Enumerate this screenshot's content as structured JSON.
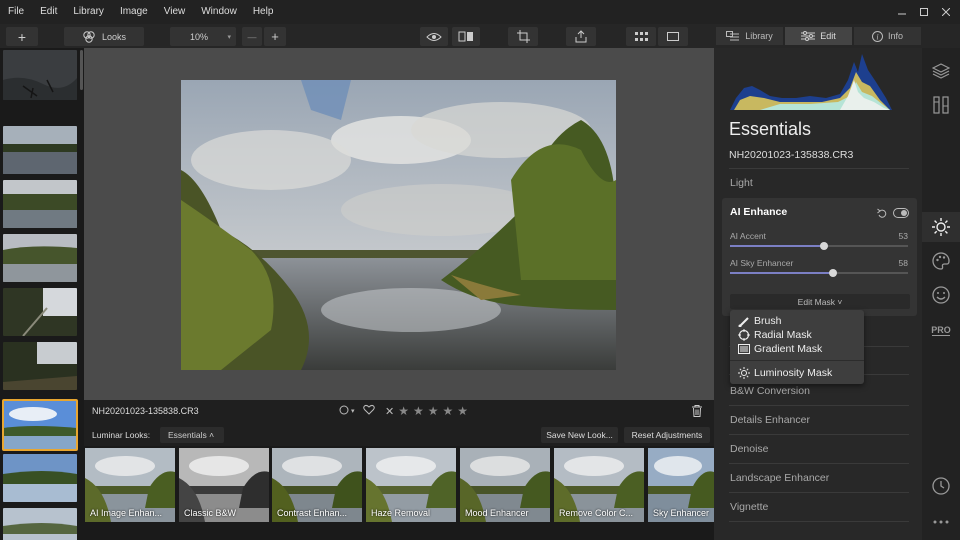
{
  "menu": [
    "File",
    "Edit",
    "Library",
    "Image",
    "View",
    "Window",
    "Help"
  ],
  "toolbar": {
    "add_label": "+",
    "looks_label": "Looks",
    "zoom_value": "10%",
    "zoom_minus": "—",
    "zoom_plus": "+"
  },
  "mode_tabs": [
    {
      "label": "Library",
      "icon": "library-icon"
    },
    {
      "label": "Edit",
      "icon": "sliders-icon"
    },
    {
      "label": "Info",
      "icon": "info-icon"
    }
  ],
  "panel": {
    "title": "Essentials",
    "filename": "NH20201023-135838.CR3",
    "light_label": "Light",
    "ai": {
      "title": "AI Enhance",
      "sliders": [
        {
          "label": "AI Accent",
          "value": 53,
          "display": "53"
        },
        {
          "label": "AI Sky Enhancer",
          "value": 58,
          "display": "58"
        }
      ],
      "edit_mask_label": "Edit Mask ˅"
    },
    "sections_below": [
      "B&W Conversion",
      "Details Enhancer",
      "Denoise",
      "Landscape Enhancer",
      "Vignette"
    ]
  },
  "mask_menu": {
    "items": [
      {
        "label": "Brush",
        "icon": "brush-icon"
      },
      {
        "label": "Radial Mask",
        "icon": "radial-mask-icon"
      },
      {
        "label": "Gradient Mask",
        "icon": "gradient-mask-icon"
      },
      {
        "label": "Luminosity Mask",
        "icon": "luminosity-icon"
      }
    ]
  },
  "image_info": {
    "filename": "NH20201023-135838.CR3",
    "rating_stars": 5,
    "x_glyph": "✕"
  },
  "looks": {
    "label": "Luminar Looks:",
    "category": "Essentials ˄",
    "save_label": "Save New Look...",
    "reset_label": "Reset Adjustments",
    "items": [
      {
        "name": "AI Image Enhan...",
        "style": "color"
      },
      {
        "name": "Classic B&W",
        "style": "bw"
      },
      {
        "name": "Contrast Enhan...",
        "style": "color"
      },
      {
        "name": "Haze Removal",
        "style": "color"
      },
      {
        "name": "Mood Enhancer",
        "style": "color"
      },
      {
        "name": "Remove Color C...",
        "style": "color"
      },
      {
        "name": "Sky Enhancer",
        "style": "color"
      }
    ]
  },
  "rail": {
    "pro_label": "PRO"
  },
  "colors": {
    "accent_selected": "#e8a630",
    "slider_fill": "#7b7fc4",
    "panel_bg": "#282828"
  }
}
